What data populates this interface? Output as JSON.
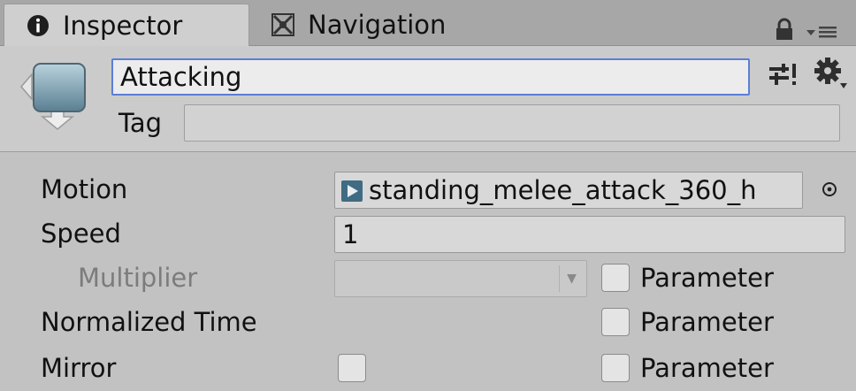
{
  "tabs": [
    {
      "label": "Inspector",
      "icon": "info-icon",
      "active": true
    },
    {
      "label": "Navigation",
      "icon": "navigation-icon",
      "active": false
    }
  ],
  "header": {
    "name_value": "Attacking",
    "tag_label": "Tag",
    "tag_value": ""
  },
  "properties": {
    "motion": {
      "label": "Motion",
      "value": "standing_melee_attack_360_h"
    },
    "speed": {
      "label": "Speed",
      "value": "1"
    },
    "multiplier": {
      "label": "Multiplier",
      "value": "",
      "parameter_label": "Parameter",
      "parameter_checked": false
    },
    "normalized_time": {
      "label": "Normalized Time",
      "parameter_label": "Parameter",
      "parameter_checked": false
    },
    "mirror": {
      "label": "Mirror",
      "checked": false,
      "parameter_label": "Parameter",
      "parameter_checked": false
    }
  },
  "colors": {
    "tab_bar": "#a7a7a7",
    "active_tab": "#cfcfcf",
    "panel": "#c2c2c2",
    "focus_border": "#5b7ed6"
  }
}
